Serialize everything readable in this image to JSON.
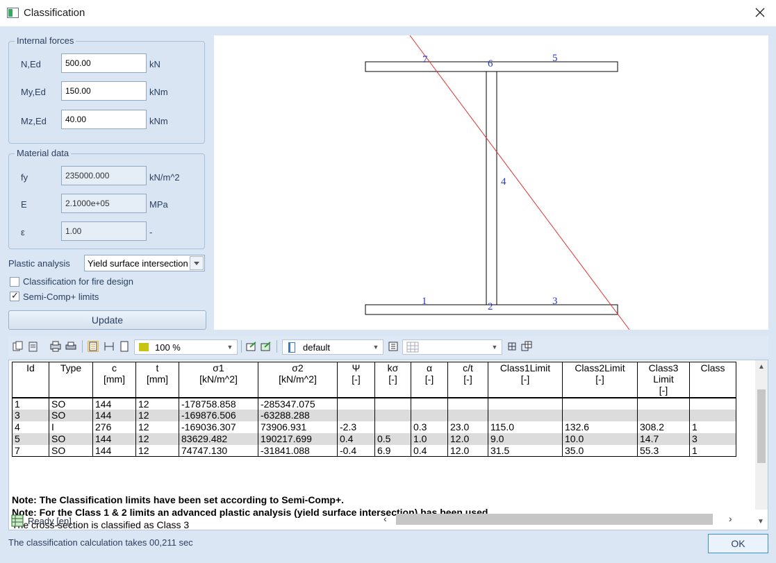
{
  "window": {
    "title": "Classification"
  },
  "internal_forces": {
    "title": "Internal forces",
    "fields": [
      {
        "label": "N,Ed",
        "value": "500.00",
        "unit": "kN"
      },
      {
        "label": "My,Ed",
        "value": "150.00",
        "unit": "kNm"
      },
      {
        "label": "Mz,Ed",
        "value": "40.00",
        "unit": "kNm"
      }
    ]
  },
  "material_data": {
    "title": "Material data",
    "fields": [
      {
        "label": "fy",
        "value": "235000.000",
        "unit": "kN/m^2"
      },
      {
        "label": "E",
        "value": "2.1000e+05",
        "unit": "MPa"
      },
      {
        "label": "ε",
        "value": "1.00",
        "unit": "-"
      }
    ]
  },
  "plastic_analysis": {
    "label": "Plastic analysis",
    "value": "Yield surface intersection"
  },
  "options": [
    {
      "label": "Classification for fire design",
      "checked": false
    },
    {
      "label": "Semi-Comp+ limits",
      "checked": true
    }
  ],
  "update_button": "Update",
  "drawing": {
    "labels": [
      "1",
      "2",
      "3",
      "4",
      "5",
      "6",
      "7"
    ],
    "line_color": "#e03030",
    "label_color": "#2a36c8"
  },
  "toolbar": {
    "zoom": "100 %",
    "style": "default",
    "icons": [
      "copy-icon",
      "paste-icon",
      "print-preview-icon",
      "print-icon",
      "fit-width-icon",
      "fit-height-icon",
      "page-icon",
      "color-swatch-icon",
      "export-icon",
      "export-all-icon",
      "style-icon",
      "table-settings-icon",
      "grid-icon",
      "small-grid-icon",
      "grid-layout-icon"
    ]
  },
  "results": {
    "headers": [
      [
        "Id"
      ],
      [
        "Type"
      ],
      [
        "c",
        "[mm]"
      ],
      [
        "t",
        "[mm]"
      ],
      [
        "σ1",
        "[kN/m^2]"
      ],
      [
        "σ2",
        "[kN/m^2]"
      ],
      [
        "Ψ",
        "[-]"
      ],
      [
        "kσ",
        "[-]"
      ],
      [
        "α",
        "[-]"
      ],
      [
        "c/t",
        "[-]"
      ],
      [
        "Class1Limit",
        "[-]"
      ],
      [
        "Class2Limit",
        "[-]"
      ],
      [
        "Class3",
        "Limit",
        "[-]"
      ],
      [
        "Class"
      ]
    ],
    "rows": [
      [
        "1",
        "SO",
        "144",
        "12",
        "-178758.858",
        "-285347.075",
        "",
        "",
        "",
        "",
        "",
        "",
        "",
        ""
      ],
      [
        "3",
        "SO",
        "144",
        "12",
        "-169876.506",
        "-63288.288",
        "",
        "",
        "",
        "",
        "",
        "",
        "",
        ""
      ],
      [
        "4",
        "I",
        "276",
        "12",
        "-169036.307",
        "73906.931",
        "-2.3",
        "",
        "0.3",
        "23.0",
        "115.0",
        "132.6",
        "308.2",
        "1"
      ],
      [
        "5",
        "SO",
        "144",
        "12",
        "83629.482",
        "190217.699",
        "0.4",
        "0.5",
        "1.0",
        "12.0",
        "9.0",
        "10.0",
        "14.7",
        "3"
      ],
      [
        "7",
        "SO",
        "144",
        "12",
        "74747.130",
        "-31841.088",
        "-0.4",
        "6.9",
        "0.4",
        "12.0",
        "31.5",
        "35.0",
        "55.3",
        "1"
      ]
    ],
    "notes": [
      "Note: The Classification limits have been set according to Semi-Comp+.",
      "Note: For the Class 1 & 2 limits an advanced plastic analysis (yield surface intersection) has been used."
    ],
    "conclusion": "The cross-section is classified as Class 3"
  },
  "status": {
    "text": "Ready [en]"
  },
  "footer": {
    "message": "The classification calculation takes 00,211 sec"
  },
  "ok_button": "OK"
}
